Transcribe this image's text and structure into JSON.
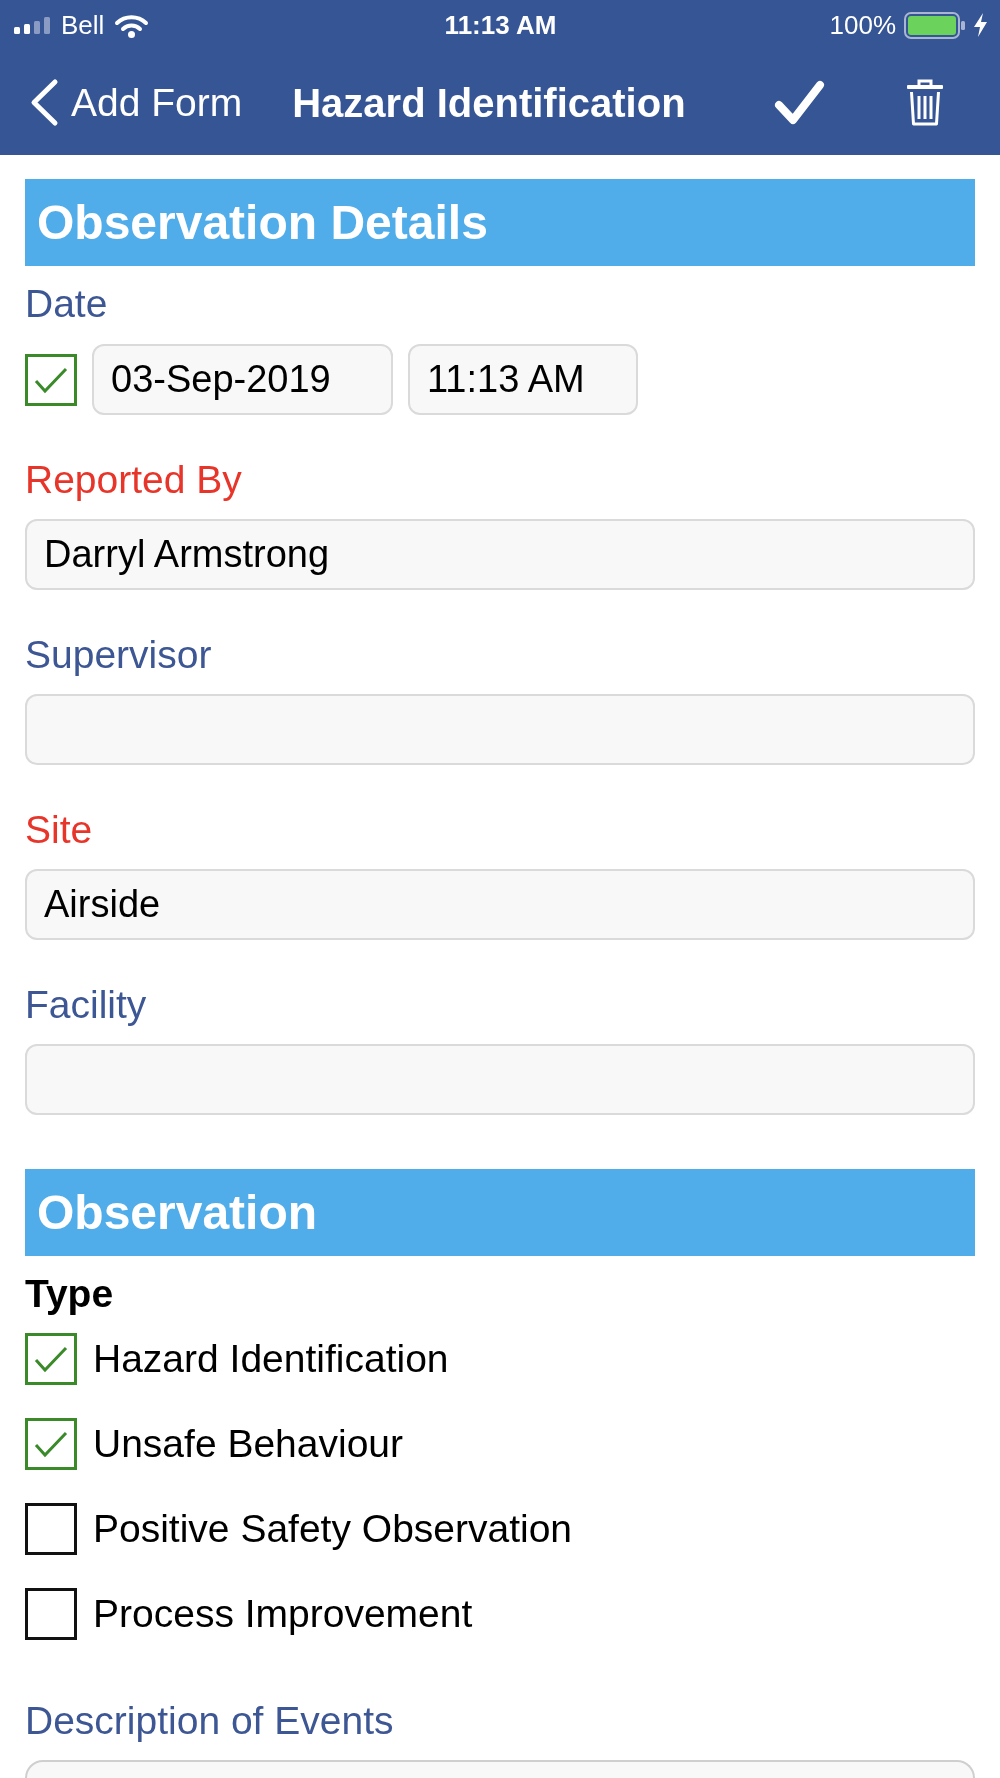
{
  "status_bar": {
    "carrier": "Bell",
    "time": "11:13 AM",
    "battery": "100%"
  },
  "nav_bar": {
    "back_label": "Add Form",
    "title": "Hazard Identification"
  },
  "sections": [
    {
      "title": "Observation Details",
      "fields": [
        {
          "kind": "datetime",
          "label": "Date",
          "required": false,
          "checked": true,
          "date": "03-Sep-2019",
          "time": "11:13 AM"
        },
        {
          "kind": "text",
          "label": "Reported By",
          "required": true,
          "value": "Darryl Armstrong"
        },
        {
          "kind": "text",
          "label": "Supervisor",
          "required": false
        },
        {
          "kind": "text",
          "label": "Site",
          "required": true,
          "value": "Airside"
        },
        {
          "kind": "text",
          "label": "Facility",
          "required": false
        }
      ]
    },
    {
      "title": "Observation",
      "fields": [
        {
          "kind": "checklist",
          "label": "Type",
          "options": [
            {
              "label": "Hazard Identification",
              "checked": true
            },
            {
              "label": "Unsafe Behaviour",
              "checked": true
            },
            {
              "label": "Positive Safety Observation",
              "checked": false
            },
            {
              "label": "Process Improvement",
              "checked": false
            }
          ]
        },
        {
          "kind": "textarea",
          "label": "Description of Events",
          "required": false
        }
      ]
    }
  ]
}
